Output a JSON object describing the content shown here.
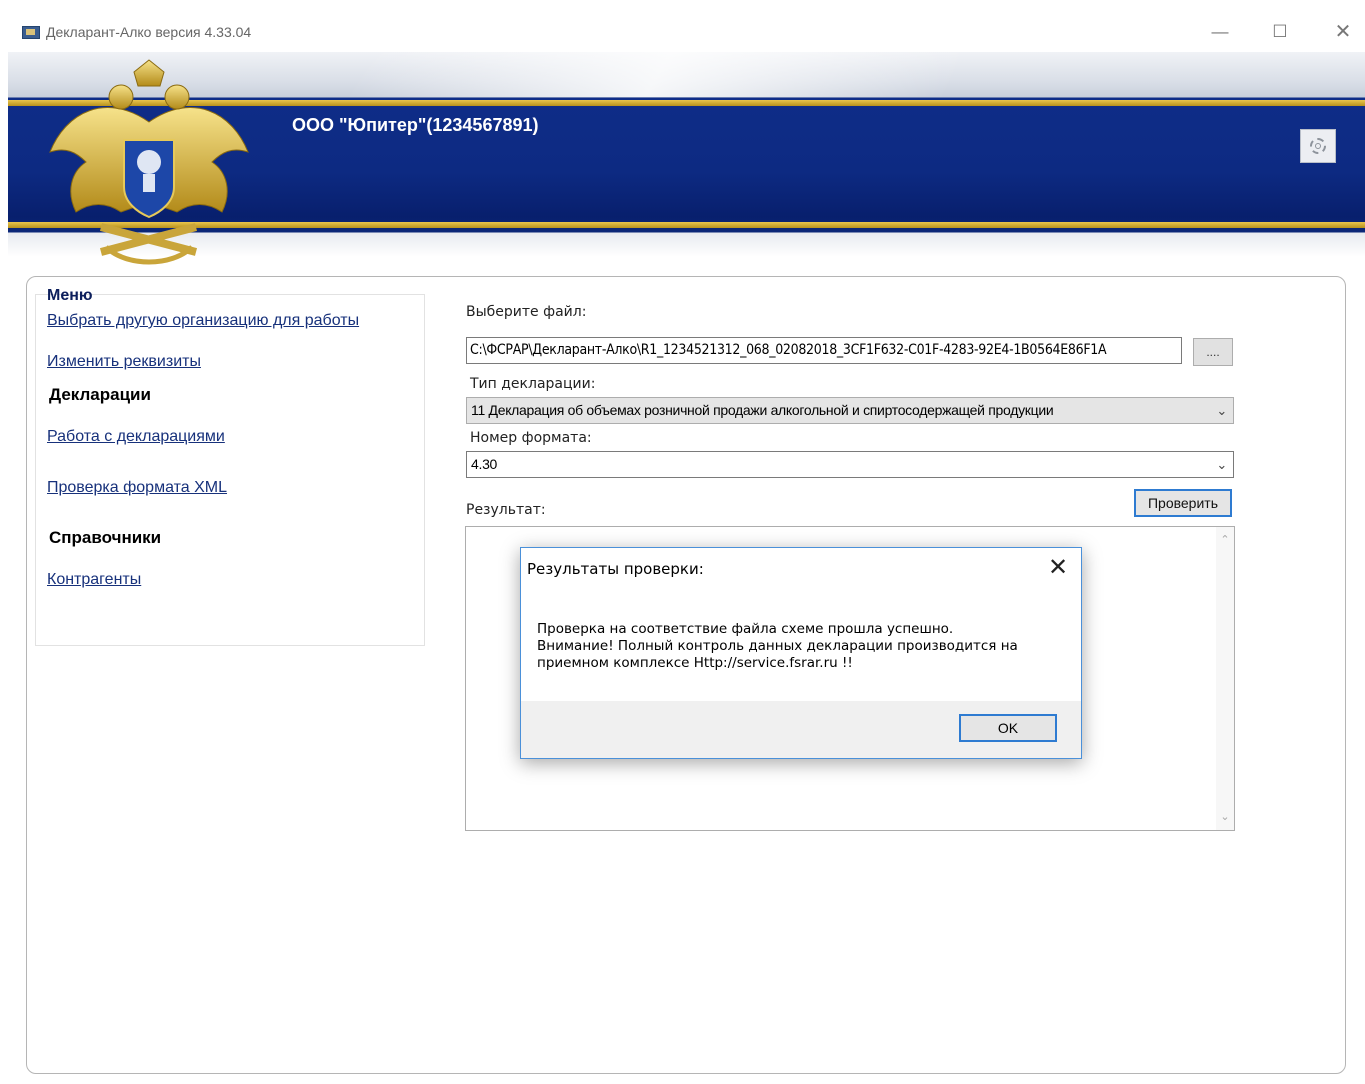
{
  "window": {
    "title": "Декларант-Алко версия 4.33.04",
    "minimize": "—",
    "maximize": "☐",
    "close": "✕"
  },
  "header": {
    "org_name": "ООО \"Юпитер\"(1234567891)",
    "settings_icon": "gear-icon",
    "emblem_icon": "double-headed-eagle-emblem"
  },
  "menu": {
    "title": "Меню",
    "change_org": "Выбрать другую организацию для работы",
    "edit_details": "Изменить реквизиты",
    "declarations_heading": "Декларации",
    "work_with_declarations": "Работа с декларациями",
    "xml_check": "Проверка формата XML",
    "references_heading": "Справочники",
    "counterparties": "Контрагенты"
  },
  "form": {
    "file_label": "Выберите файл:",
    "file_value": "C:\\ФСРАР\\Декларант-Алко\\R1_1234521312_068_02082018_3CF1F632-C01F-4283-92E4-1B0564E86F1A",
    "browse_label": "....",
    "decl_type_label": "Тип декларации:",
    "decl_type_value": "11 Декларация об объемах розничной продажи алкогольной и спиртосодержащей продукции",
    "format_label": "Номер формата:",
    "format_value": "4.30",
    "check_button": "Проверить",
    "result_label": "Результат:"
  },
  "dialog": {
    "title": "Результаты проверки:",
    "close": "✕",
    "line1": "Проверка на соответствие файла схеме прошла успешно.",
    "line2": " Внимание! Полный контроль данных декларации производится на",
    "line3": "приемном комплексе Http://service.fsrar.ru !!",
    "ok_button": "OK"
  },
  "colors": {
    "header_blue": "#0d2a82",
    "gold_stripe": "#d8b43a",
    "link": "#17317b",
    "focus_border": "#2e7bd1"
  }
}
